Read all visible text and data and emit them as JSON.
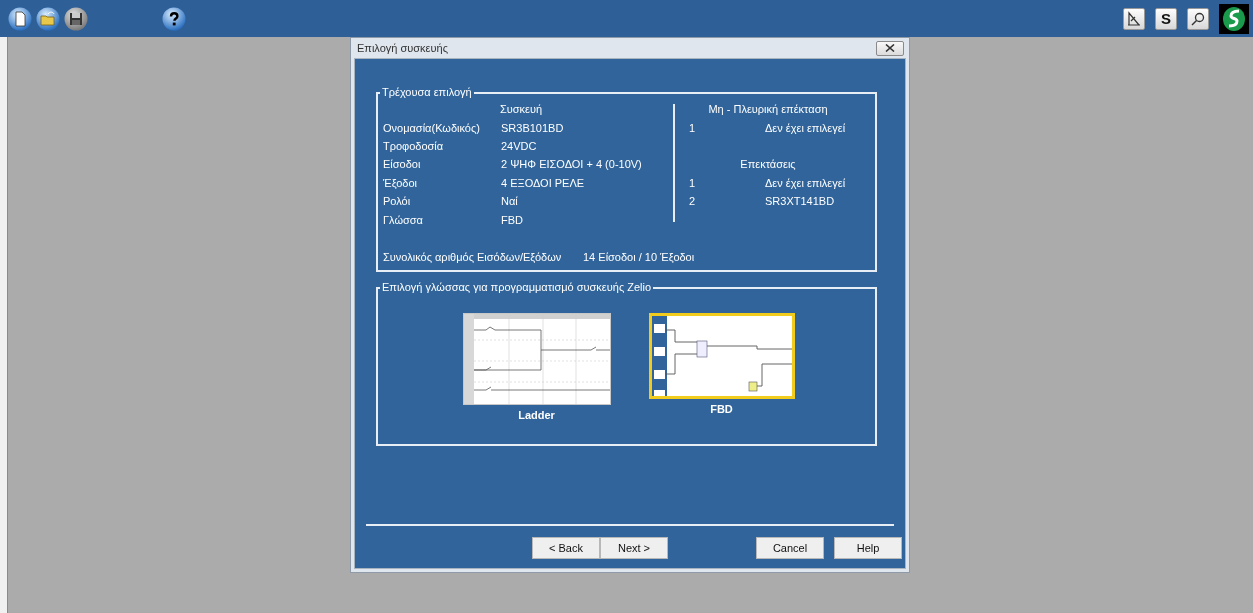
{
  "toolbar": {
    "left": [
      {
        "kind": "new",
        "disabled": false
      },
      {
        "kind": "open",
        "disabled": false
      },
      {
        "kind": "save",
        "disabled": true
      },
      {
        "kind": "help",
        "disabled": false
      }
    ],
    "right": [
      {
        "kind": "chart"
      },
      {
        "kind": "text",
        "label": "S"
      },
      {
        "kind": "search"
      },
      {
        "kind": "logo"
      }
    ]
  },
  "dialog": {
    "title": "Επιλογή συσκευής",
    "current": {
      "legend": "Τρέχουσα επιλογή",
      "device_header": "Συσκευή",
      "properties": [
        {
          "label": "Ονομασία(Κωδικός)",
          "value": "SR3B101BD"
        },
        {
          "label": "Τροφοδοσία",
          "value": "24VDC"
        },
        {
          "label": "Είσοδοι",
          "value": "2 ΨΗΦ ΕΙΣΟΔΟΙ + 4 (0-10V)"
        },
        {
          "label": "Έξοδοι",
          "value": "4 ΕΞΟΔΟΙ ΡΕΛΕ"
        },
        {
          "label": "Ρολόι",
          "value": "Ναί"
        },
        {
          "label": "Γλώσσα",
          "value": "FBD"
        }
      ],
      "non_lateral_header": "Μη - Πλευρική επέκταση",
      "non_lateral": [
        {
          "number": "1",
          "value": "Δεν έχει επιλεγεί"
        }
      ],
      "extensions_header": "Επεκτάσεις",
      "extensions": [
        {
          "number": "1",
          "value": "Δεν έχει επιλεγεί"
        },
        {
          "number": "2",
          "value": "SR3XT141BD"
        }
      ],
      "total_label": "Συνολικός αριθμός Εισόδων/Εξόδων",
      "total_value": "14 Είσοδοι / 10 Έξοδοι"
    },
    "language": {
      "legend": "Επιλογή γλώσσας για προγραμματισμό συσκευής Zelio",
      "options": [
        {
          "kind": "ladder",
          "label": "Ladder",
          "selected": false
        },
        {
          "kind": "fbd",
          "label": "FBD",
          "selected": true
        }
      ]
    },
    "buttons": [
      {
        "label": "< Back"
      },
      {
        "label": "Next >"
      },
      {
        "label": "Cancel"
      },
      {
        "label": "Help"
      }
    ]
  }
}
